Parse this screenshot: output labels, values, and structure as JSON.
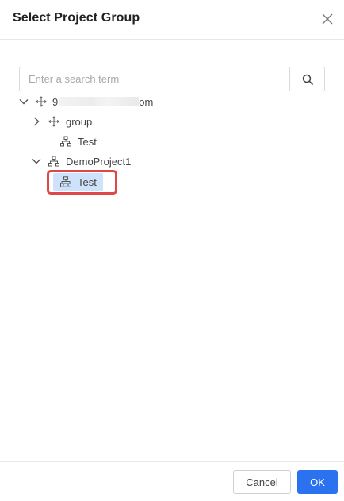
{
  "dialog": {
    "title": "Select Project Group",
    "close_icon": "close-icon"
  },
  "search": {
    "placeholder": "Enter a search term",
    "value": "",
    "icon": "search-icon"
  },
  "tree": {
    "root": {
      "label_prefix": "9",
      "label_suffix": "om",
      "expanded": true,
      "icon": "move-icon"
    },
    "group": {
      "label": "group",
      "expanded": false,
      "icon": "move-icon"
    },
    "group_test": {
      "label": "Test",
      "icon": "hierarchy-icon"
    },
    "demo": {
      "label": "DemoProject1",
      "expanded": true,
      "icon": "hierarchy-icon"
    },
    "demo_test": {
      "label": "Test",
      "icon": "project-node-icon",
      "selected": true
    }
  },
  "colors": {
    "selected_bg": "#cfe2fb",
    "highlight_border": "#e04848",
    "primary": "#2a72f0"
  },
  "footer": {
    "cancel_label": "Cancel",
    "ok_label": "OK"
  }
}
